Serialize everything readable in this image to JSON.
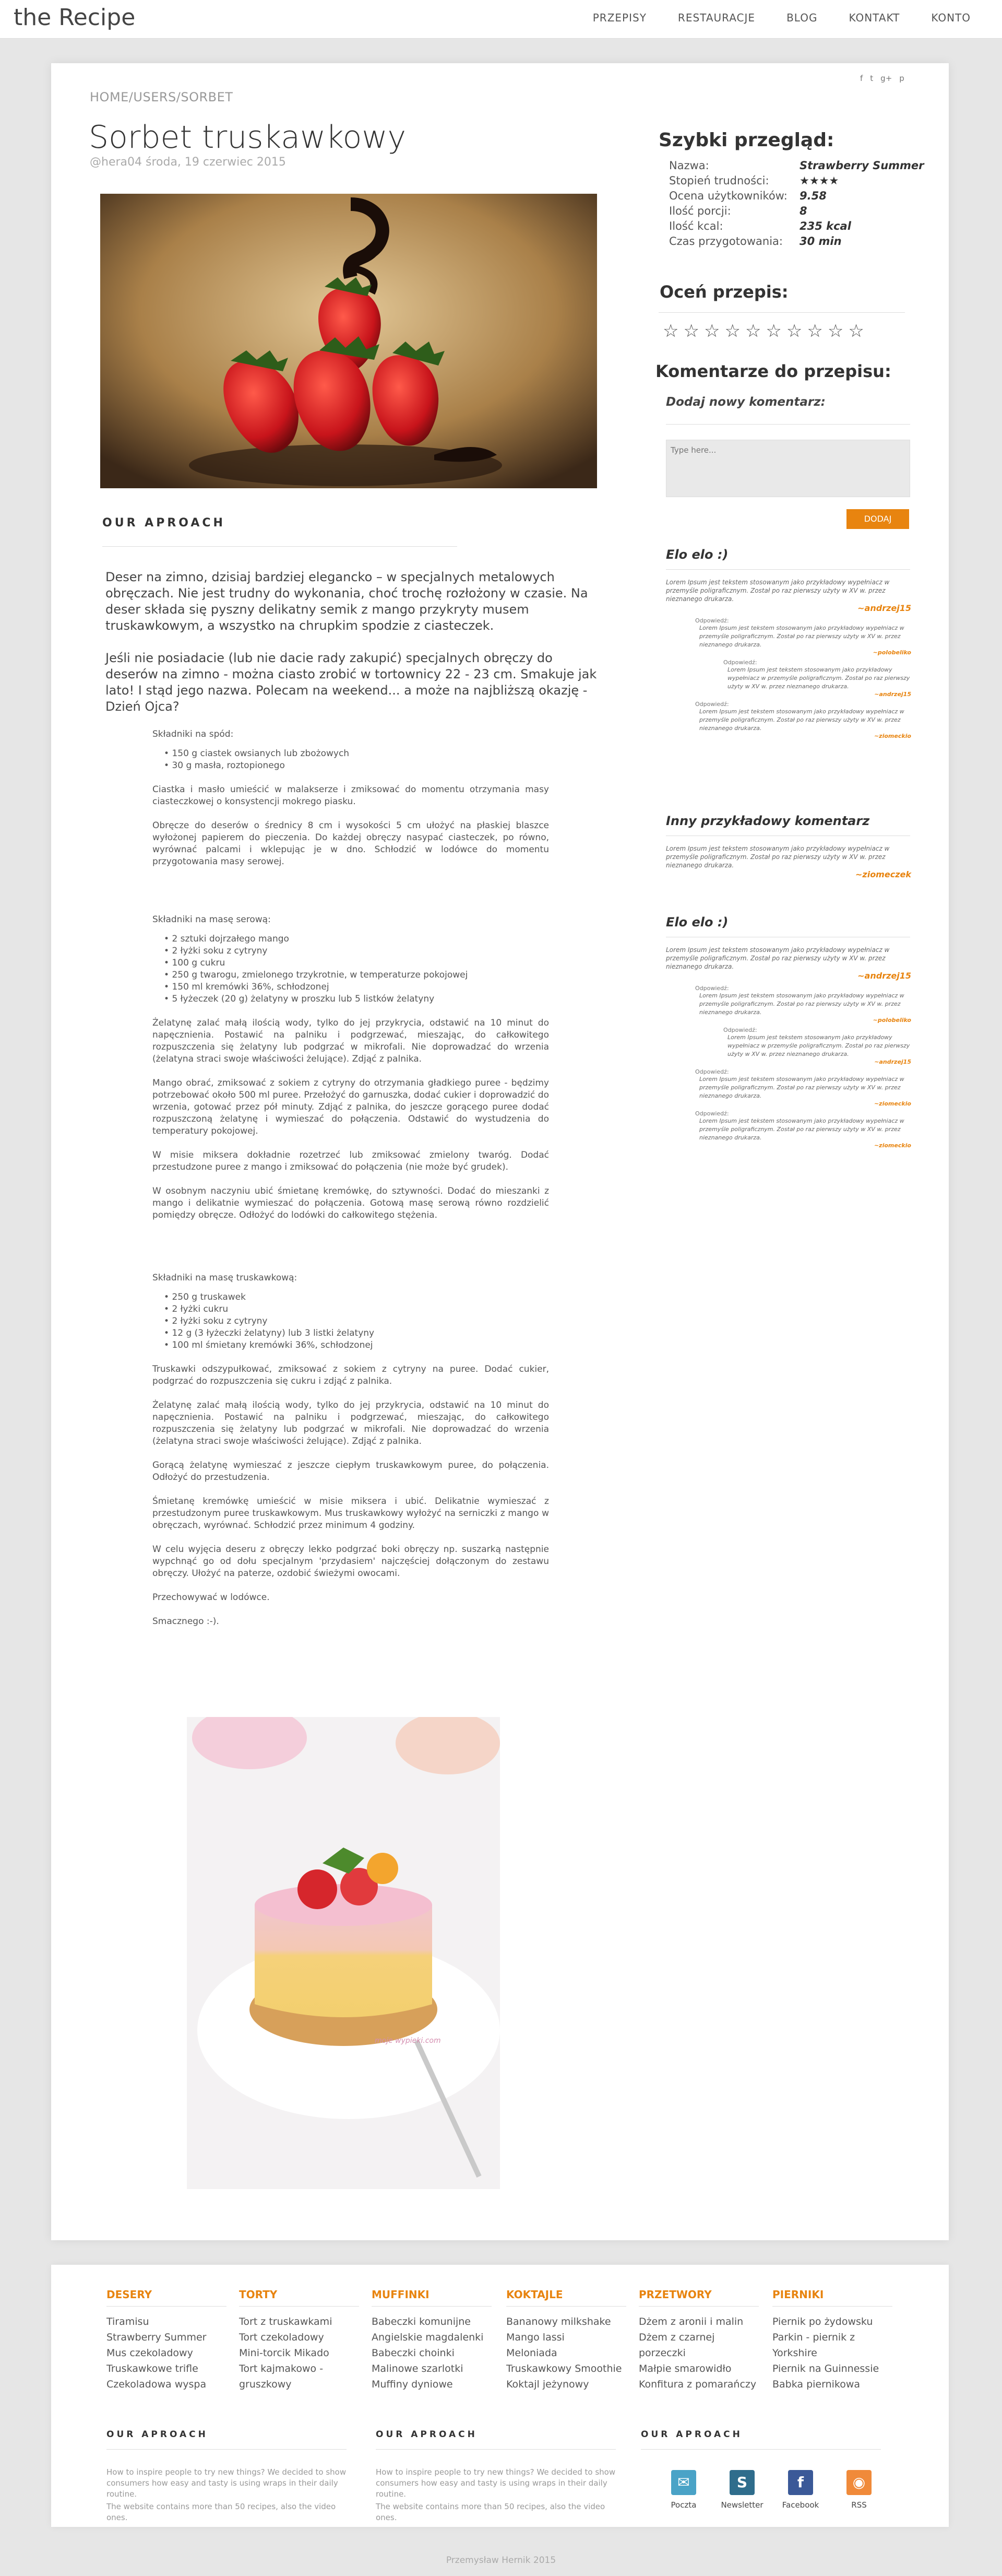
{
  "header": {
    "logo": "the Recipe",
    "nav": [
      "PRZEPISY",
      "RESTAURACJE",
      "BLOG",
      "KONTAKT",
      "KONTO"
    ]
  },
  "social_icons": [
    "facebook-icon",
    "twitter-icon",
    "google-plus-icon",
    "pinterest-icon"
  ],
  "social_glyphs": [
    "f",
    "t",
    "g+",
    "p"
  ],
  "breadcrumb": "HOME/USERS/SORBET",
  "title": "Sorbet truskawkowy",
  "author": "@hera04  środa, 19 czerwiec 2015",
  "section_heading": "OUR APROACH",
  "intro": [
    "Deser na zimno, dzisiaj bardziej elegancko – w specjalnych metalowych obręczach. Nie jest trudny do wykonania, choć trochę rozłożony w czasie. Na deser składa się pyszny delikatny semik z mango przykryty musem truskawkowym, a wszystko na chrupkim spodzie z ciasteczek.",
    "Jeśli nie posiadacie (lub nie dacie rady zakupić) specjalnych obręczy do deserów na zimno - można ciasto zrobić w tortownicy 22 - 23 cm. Smakuje jak lato! I stąd jego nazwa. Polecam na weekend... a może na najbliższą okazję - Dzień Ojca?"
  ],
  "recipe": {
    "base_title": "Składniki na spód:",
    "base_items": [
      "150 g ciastek owsianych lub zbożowych",
      "30 g masła, roztopionego"
    ],
    "base_steps": [
      "Ciastka i masło umieścić w malakserze i zmiksować do momentu otrzymania masy ciasteczkowej o konsystencji mokrego piasku.",
      "Obręcze do deserów o średnicy 8 cm i wysokości 5 cm ułożyć na płaskiej blaszce wyłożonej papierem do pieczenia. Do każdej obręczy nasypać ciasteczek, po równo, wyrównać palcami i wklepując je w dno. Schłodzić w lodówce do momentu przygotowania masy serowej."
    ],
    "cheese_title": "Składniki na masę serową:",
    "cheese_items": [
      "2 sztuki dojrzałego mango",
      "2 łyżki soku z cytryny",
      "100 g cukru",
      "250 g twarogu, zmielonego trzykrotnie, w temperaturze pokojowej",
      "150 ml kremówki 36%, schłodzonej",
      "5 łyżeczek (20 g) żelatyny w proszku lub 5 listków żelatyny"
    ],
    "cheese_steps": [
      "Żelatynę zalać małą ilością wody, tylko do jej przykrycia, odstawić na 10 minut do napęcznienia. Postawić na palniku i podgrzewać, mieszając, do całkowitego rozpuszczenia się żelatyny lub podgrzać w mikrofali. Nie doprowadzać do wrzenia (żelatyna straci swoje właściwości żelujące). Zdjąć z palnika.",
      "Mango obrać, zmiksować z sokiem z cytryny do otrzymania gładkiego puree - będzimy potrzebować około 500 ml puree. Przełożyć do garnuszka, dodać cukier i doprowadzić do wrzenia, gotować przez pół minuty. Zdjąć z palnika, do jeszcze gorącego puree dodać rozpuszczoną żelatynę i wymieszać do połączenia. Odstawić do wystudzenia do temperatury pokojowej.",
      "W misie miksera dokładnie rozetrzeć lub zmiksować zmielony twaróg. Dodać przestudzone puree z mango i zmiksować do połączenia (nie może być grudek).",
      "W osobnym naczyniu ubić śmietanę kremówkę, do sztywności. Dodać do mieszanki z mango i delikatnie wymieszać do połączenia. Gotową masę serową równo rozdzielić pomiędzy obręcze. Odłożyć do lodówki do całkowitego stężenia."
    ],
    "mousse_title": "Składniki na masę truskawkową:",
    "mousse_items": [
      "250 g truskawek",
      "2 łyżki cukru",
      "2 łyżki soku z cytryny",
      "12 g (3 łyżeczki żelatyny) lub 3 listki żelatyny",
      "100 ml śmietany kremówki 36%, schłodzonej"
    ],
    "mousse_steps": [
      "Truskawki odszypułkować, zmiksować z sokiem z cytryny na puree. Dodać cukier, podgrzać do rozpuszczenia się cukru i zdjąć z palnika.",
      "Żelatynę zalać małą ilością wody, tylko do jej przykrycia, odstawić na 10 minut do napęcznienia. Postawić na palniku i podgrzewać, mieszając, do całkowitego rozpuszczenia się żelatyny lub podgrzać w mikrofali. Nie doprowadzać do wrzenia (żelatyna straci swoje właściwości żelujące). Zdjąć z palnika.",
      "Gorącą żelatynę wymieszać z jeszcze ciepłym truskawkowym puree, do połączenia. Odłożyć do przestudzenia.",
      "Śmietanę kremówkę umieścić w misie miksera i ubić. Delikatnie wymieszać z przestudzonym puree truskawkowym. Mus truskawkowy wyłożyć na serniczki z mango w obręczach, wyrównać. Schłodzić przez minimum 4 godziny.",
      "W celu wyjęcia deseru z obręczy lekko podgrzać boki obręczy np. suszarką następnie wypchnąć go od dołu specjalnym 'przydasiem' najczęściej dołączonym do zestawu obręczy. Ułożyć na paterze, ozdobić świeżymi owocami.",
      "Przechowywać w lodówce.",
      "Smacznego :-)."
    ],
    "watermark": "moje wypieki.com"
  },
  "quick_view": {
    "title": "Szybki przegląd:",
    "rows": [
      {
        "k": "Nazwa:",
        "v": "Strawberry Summer"
      },
      {
        "k": "Stopień trudności:",
        "v": "★★★★"
      },
      {
        "k": "Ocena użytkowników:",
        "v": "9.58"
      },
      {
        "k": "Ilość porcji:",
        "v": "8"
      },
      {
        "k": "Ilość kcal:",
        "v": "235 kcal"
      },
      {
        "k": "Czas przygotowania:",
        "v": "30 min"
      }
    ]
  },
  "rate": {
    "title": "Oceń przepis:",
    "stars": 10
  },
  "comments": {
    "title": "Komentarze do przepisu:",
    "add_label": "Dodaj nowy komentarz:",
    "placeholder": "Type here...",
    "button": "DODAJ",
    "lorem": "Lorem Ipsum jest tekstem stosowanym jako przykładowy wypełniacz w przemyśle poligraficznym. Został po raz pierwszy użyty w XV w. przez nieznanego drukarza.",
    "reply_label": "Odpowiedź:",
    "threads": [
      {
        "title": "Elo elo :)",
        "author": "~andrzej15",
        "replies": [
          {
            "author": "~polobeliko",
            "indent": 0
          },
          {
            "author": "~andrzej15",
            "indent": 1
          },
          {
            "author": "~ziomeckio",
            "indent": 0
          }
        ]
      },
      {
        "title": "Inny przykładowy komentarz",
        "author": "~ziomeczek",
        "replies": []
      },
      {
        "title": "Elo elo :)",
        "author": "~andrzej15",
        "replies": [
          {
            "author": "~polobeliko",
            "indent": 0
          },
          {
            "author": "~andrzej15",
            "indent": 1
          },
          {
            "author": "~ziomeckio",
            "indent": 0
          },
          {
            "author": "~ziomeckio",
            "indent": 0
          }
        ]
      }
    ]
  },
  "footer": {
    "columns": [
      {
        "title": "DESERY",
        "items": [
          "Tiramisu",
          "Strawberry Summer",
          "Mus czekoladowy",
          "Truskawkowe trifle",
          "Czekoladowa wyspa"
        ]
      },
      {
        "title": "TORTY",
        "items": [
          "Tort z truskawkami",
          "Tort czekoladowy",
          "Mini-torcik Mikado",
          "Tort kajmakowo -",
          "gruszkowy"
        ]
      },
      {
        "title": "MUFFINKI",
        "items": [
          "Babeczki komunijne",
          "Angielskie magdalenki",
          "Babeczki choinki",
          "Malinowe szarlotki",
          "Muffiny dyniowe"
        ]
      },
      {
        "title": "KOKTAJLE",
        "items": [
          "Bananowy milkshake",
          "Mango lassi",
          "Meloniada",
          "Truskawkowy Smoothie",
          "Koktajl jeżynowy"
        ]
      },
      {
        "title": "PRZETWORY",
        "items": [
          "Dżem z aronii i malin",
          "Dżem z czarnej",
          "porzeczki",
          "Małpie smarowidło",
          "Konfitura z pomarańczy"
        ]
      },
      {
        "title": "PIERNIKI",
        "items": [
          "Piernik po żydowsku",
          "Parkin - piernik z",
          "Yorkshire",
          "Piernik na Guinnessie",
          "Babka piernikowa"
        ]
      }
    ],
    "sections": [
      {
        "title": "OUR APROACH",
        "text": "How to inspire people to try new things? We decided to show consumers how easy and tasty is using wraps in their daily routine.",
        "text2": "The website contains more than 50 recipes, also the video ones."
      },
      {
        "title": "OUR APROACH",
        "text": "How to inspire people to try new things? We decided to show consumers how easy and tasty is using wraps in their daily routine.",
        "text2": "The website contains more than 50 recipes, also the video ones."
      },
      {
        "title": "OUR APROACH"
      }
    ],
    "icons": [
      {
        "label": "Poczta",
        "icon": "mail-icon",
        "glyph": "✉",
        "color": "#4aa3c7"
      },
      {
        "label": "Newsletter",
        "icon": "newsletter-icon",
        "glyph": "S",
        "color": "#2f6d8c"
      },
      {
        "label": "Facebook",
        "icon": "facebook-icon",
        "glyph": "f",
        "color": "#3b5998"
      },
      {
        "label": "RSS",
        "icon": "rss-icon",
        "glyph": "◉",
        "color": "#f08a3a"
      }
    ],
    "copyright": "Przemysław Hernik 2015"
  }
}
